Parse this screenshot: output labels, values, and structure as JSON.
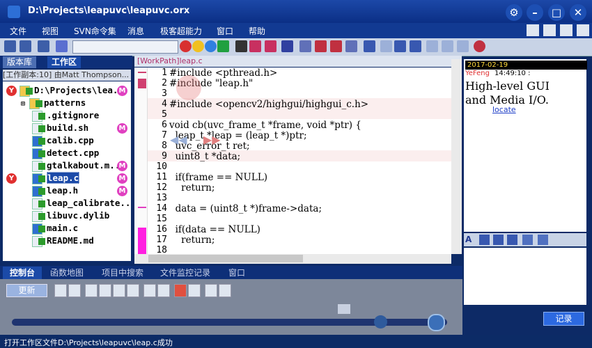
{
  "window": {
    "title": "D:\\Projects\\leapuvc\\leapuvc.orx",
    "controls": [
      "settings",
      "minimize",
      "maximize",
      "close"
    ]
  },
  "menu": [
    "文件",
    "视图",
    "SVN命令集",
    "消息",
    "极客超能力",
    "窗口",
    "帮助"
  ],
  "left_panel": {
    "tabs": [
      "版本库",
      "工作区"
    ],
    "active_tab": "工作区",
    "workspace_header": "[工作副本:10] 由Matt Thompson...",
    "tree": [
      {
        "label": "D:\\Projects\\lea...",
        "type": "root"
      },
      {
        "label": "patterns",
        "type": "folder"
      },
      {
        "label": ".gitignore",
        "type": "file"
      },
      {
        "label": "build.sh",
        "type": "file"
      },
      {
        "label": "calib.cpp",
        "type": "file"
      },
      {
        "label": "detect.cpp",
        "type": "file"
      },
      {
        "label": "gtalkabout.m...",
        "type": "file"
      },
      {
        "label": "leap.c",
        "type": "file",
        "selected": true
      },
      {
        "label": "leap.h",
        "type": "file"
      },
      {
        "label": "leap_calibrate...",
        "type": "file"
      },
      {
        "label": "libuvc.dylib",
        "type": "file"
      },
      {
        "label": "main.c",
        "type": "file"
      },
      {
        "label": "README.md",
        "type": "file"
      }
    ]
  },
  "editor": {
    "tab_label": "[WorkPath]leap.c",
    "lines": [
      {
        "n": "1",
        "text": "#include <pthread.h>"
      },
      {
        "n": "2",
        "text": "#include \"leap.h\""
      },
      {
        "n": "3",
        "text": ""
      },
      {
        "n": "4",
        "text": "#include <opencv2/highgui/highgui_c.h>"
      },
      {
        "n": "5",
        "text": ""
      },
      {
        "n": "6",
        "text": "void cb(uvc_frame_t *frame, void *ptr) {"
      },
      {
        "n": "7",
        "text": "  leap_t *leap = (leap_t *)ptr;"
      },
      {
        "n": "8",
        "text": "  uvc_error_t ret;"
      },
      {
        "n": "9",
        "text": "  uint8_t *data;"
      },
      {
        "n": "10",
        "text": ""
      },
      {
        "n": "11",
        "text": "  if(frame == NULL)"
      },
      {
        "n": "12",
        "text": "    return;"
      },
      {
        "n": "13",
        "text": ""
      },
      {
        "n": "14",
        "text": "  data = (uint8_t *)frame->data;"
      },
      {
        "n": "15",
        "text": ""
      },
      {
        "n": "16",
        "text": "  if(data == NULL)"
      },
      {
        "n": "17",
        "text": "    return;"
      },
      {
        "n": "18",
        "text": ""
      }
    ]
  },
  "right_panel": {
    "date": "2017-02-19",
    "author": "YeFeng",
    "time": "14:49:10 :",
    "message": "High-level GUI\nand Media I/O.",
    "link": "locate",
    "record_button": "记录"
  },
  "bottom": {
    "tabs": [
      "控制台",
      "函数地图",
      "项目中搜索",
      "文件监控记录",
      "窗口"
    ],
    "active_tab": "控制台",
    "update_button": "更新"
  },
  "status": "打开工作区文件D:\\Projects\\leapuvc\\leap.c成功"
}
